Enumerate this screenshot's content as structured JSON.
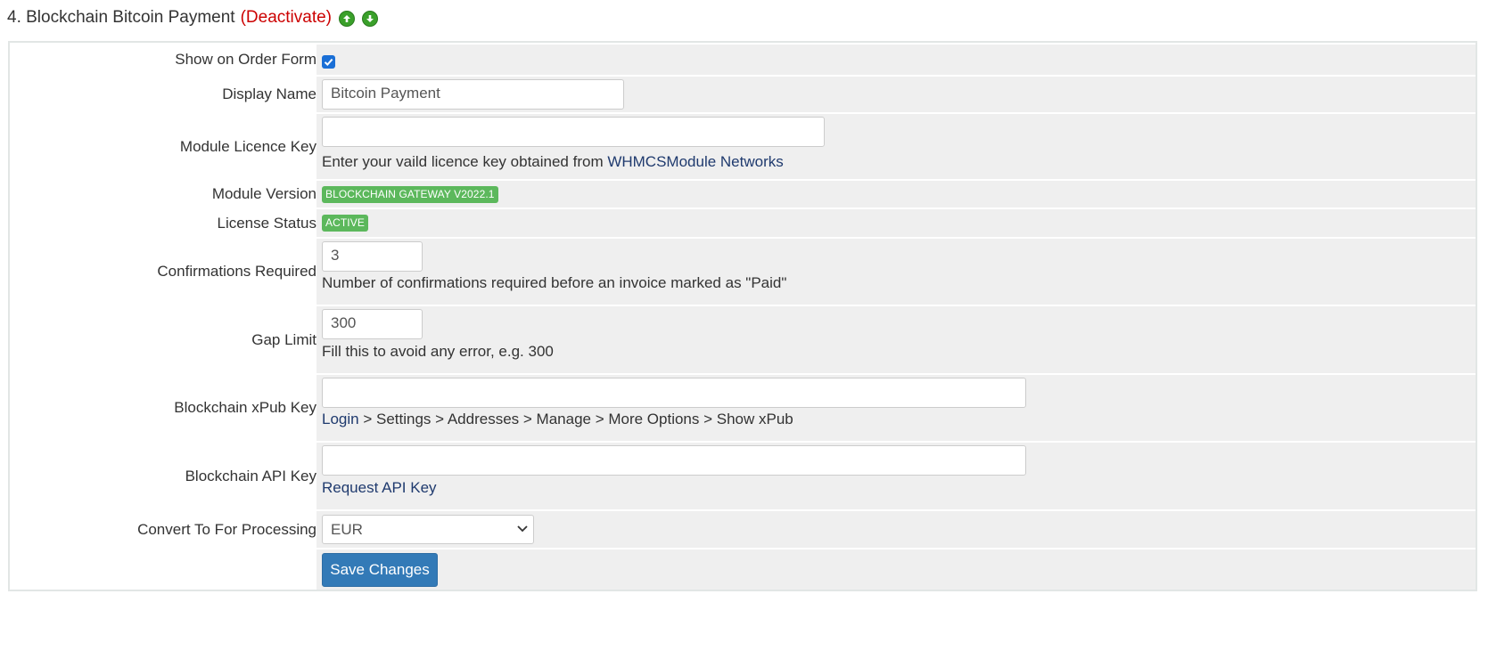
{
  "header": {
    "title": "4. Blockchain Bitcoin Payment",
    "deactivate_label": "(Deactivate)"
  },
  "form": {
    "show_on_order_form": {
      "label": "Show on Order Form",
      "checked": true
    },
    "display_name": {
      "label": "Display Name",
      "value": "Bitcoin Payment"
    },
    "module_licence_key": {
      "label": "Module Licence Key",
      "value": "",
      "help_prefix": "Enter your vaild licence key obtained from ",
      "help_link": "WHMCSModule Networks"
    },
    "module_version": {
      "label": "Module Version",
      "badge": "BLOCKCHAIN GATEWAY V2022.1"
    },
    "license_status": {
      "label": "License Status",
      "badge": "ACTIVE"
    },
    "confirmations_required": {
      "label": "Confirmations Required",
      "value": "3",
      "help": "Number of confirmations required before an invoice marked as \"Paid\""
    },
    "gap_limit": {
      "label": "Gap Limit",
      "value": "300",
      "help": "Fill this to avoid any error, e.g. 300"
    },
    "xpub_key": {
      "label": "Blockchain xPub Key",
      "value": "",
      "help_link": "Login",
      "help_rest": " > Settings > Addresses > Manage > More Options > Show xPub"
    },
    "api_key": {
      "label": "Blockchain API Key",
      "value": "",
      "help_link": "Request API Key"
    },
    "convert_to": {
      "label": "Convert To For Processing",
      "selected": "EUR"
    },
    "save_button": "Save Changes"
  },
  "colors": {
    "deactivate": "#cc0000",
    "badge_green": "#5cb85c",
    "button_blue": "#337ab7",
    "link": "#1f3a6e"
  },
  "icons": [
    "arrow-up-icon",
    "arrow-down-icon",
    "checkmark-icon",
    "chevron-down-icon"
  ]
}
